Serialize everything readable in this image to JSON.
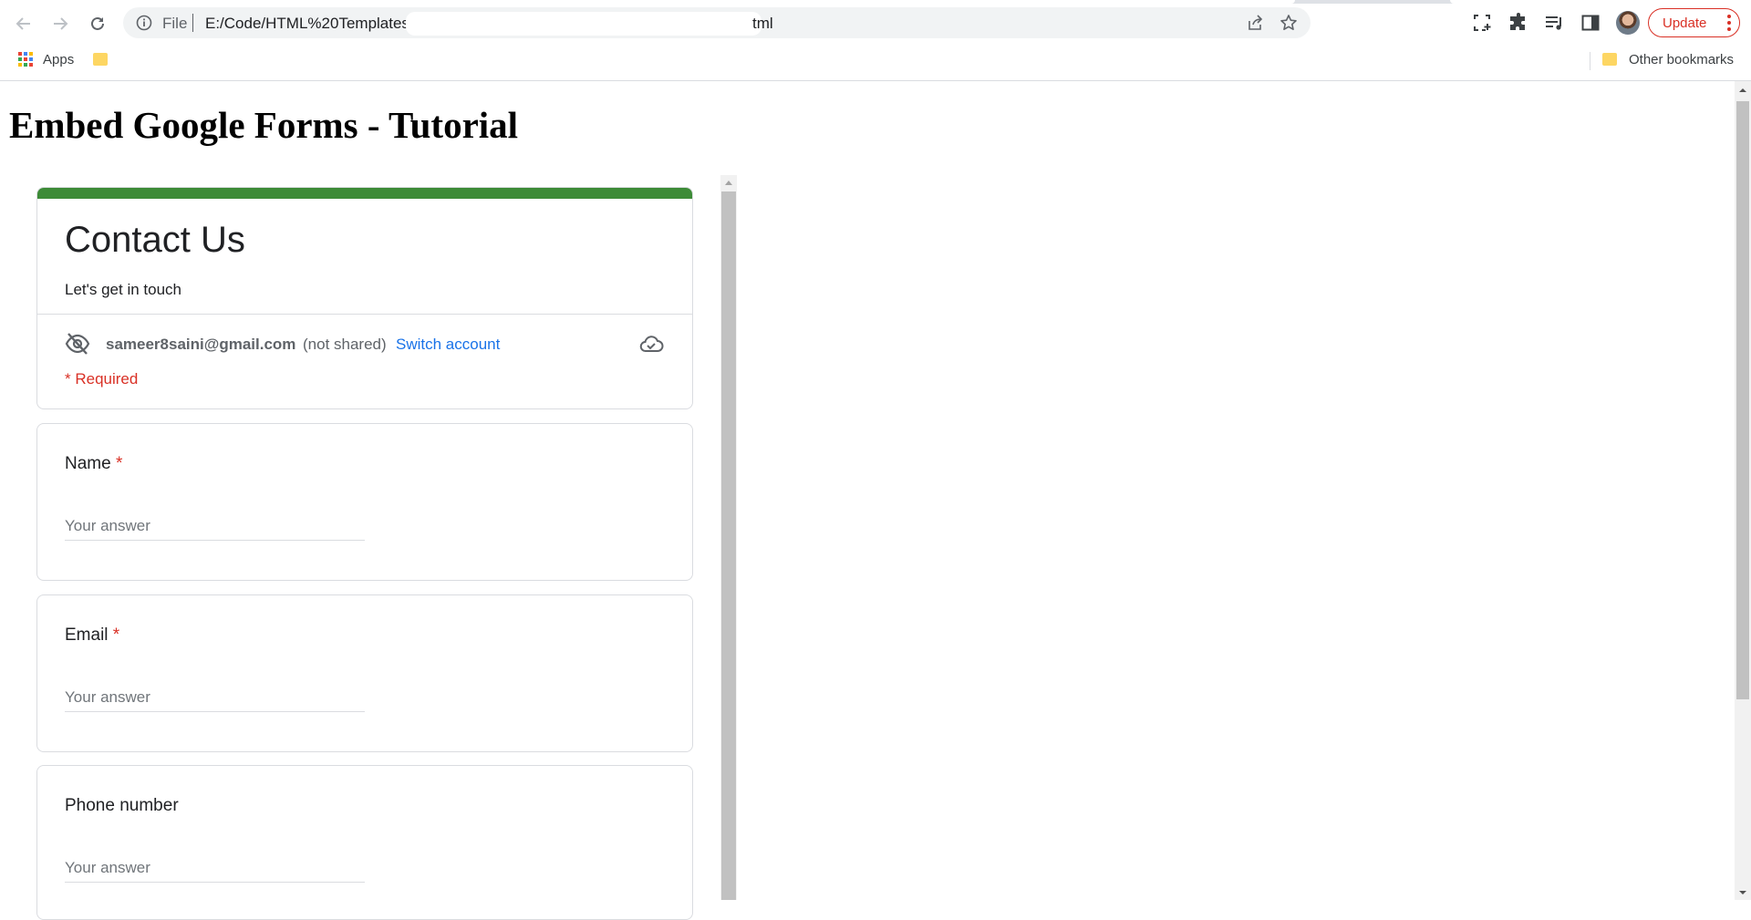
{
  "browser": {
    "scheme_label": "File",
    "url_start": "E:/Code/HTML%20Templates",
    "url_end": "tml",
    "update_label": "Update",
    "colors": {
      "update_red": "#d93025",
      "omnibox_bg": "#f1f3f4"
    }
  },
  "bookmarks": {
    "apps_label": "Apps",
    "other_label": "Other bookmarks"
  },
  "page": {
    "title": "Embed Google Forms - Tutorial"
  },
  "form": {
    "accent_color": "#3d8b37",
    "title": "Contact Us",
    "description": "Let's get in touch",
    "account_email": "sameer8saini@gmail.com",
    "not_shared": "(not shared)",
    "switch_account": "Switch account",
    "required_note": "* Required",
    "questions": [
      {
        "label": "Name",
        "required_mark": "*",
        "placeholder": "Your answer"
      },
      {
        "label": "Email",
        "required_mark": "*",
        "placeholder": "Your answer"
      },
      {
        "label": "Phone number",
        "required_mark": "",
        "placeholder": "Your answer"
      }
    ]
  },
  "icons": [
    "back-arrow-icon",
    "forward-arrow-icon",
    "reload-icon",
    "info-icon",
    "share-icon",
    "star-icon",
    "screenshot-icon",
    "extensions-puzzle-icon",
    "media-queue-icon",
    "side-panel-icon",
    "apps-grid-icon",
    "folder-icon",
    "eye-off-icon",
    "cloud-done-icon"
  ]
}
